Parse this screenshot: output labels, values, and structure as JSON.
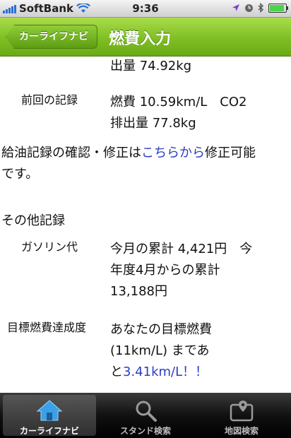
{
  "statusbar": {
    "carrier": "SoftBank",
    "time": "9:36"
  },
  "navbar": {
    "back_label": "カーライフナビ",
    "title": "燃費入力"
  },
  "content": {
    "partial_line": "出量 74.92kg",
    "prev_label": "前回の記録",
    "prev_line1": "燃費 10.59km/L　CO2",
    "prev_line2": "排出量 77.8kg",
    "edit_text_1": "給油記録の確認・修正は",
    "edit_link": "こちらから",
    "edit_text_2": "修正可能",
    "edit_text_3": "です。",
    "other_heading": "その他記録",
    "gas_label": "ガソリン代",
    "gas_line1": "今月の累計 4,421円　今",
    "gas_line2": "年度4月からの累計",
    "gas_line3": "13,188円",
    "goal_label": "目標燃費達成度",
    "goal_line1": "あなたの目標燃費",
    "goal_line2": "(11km/L) まであ",
    "goal_line3_a": "と",
    "goal_line3_link": "3.41km/L！！"
  },
  "tabbar": {
    "tabs": [
      {
        "label": "カーライフナビ",
        "icon": "home-icon"
      },
      {
        "label": "スタンド検索",
        "icon": "search-icon"
      },
      {
        "label": "地図検索",
        "icon": "map-icon"
      }
    ]
  }
}
